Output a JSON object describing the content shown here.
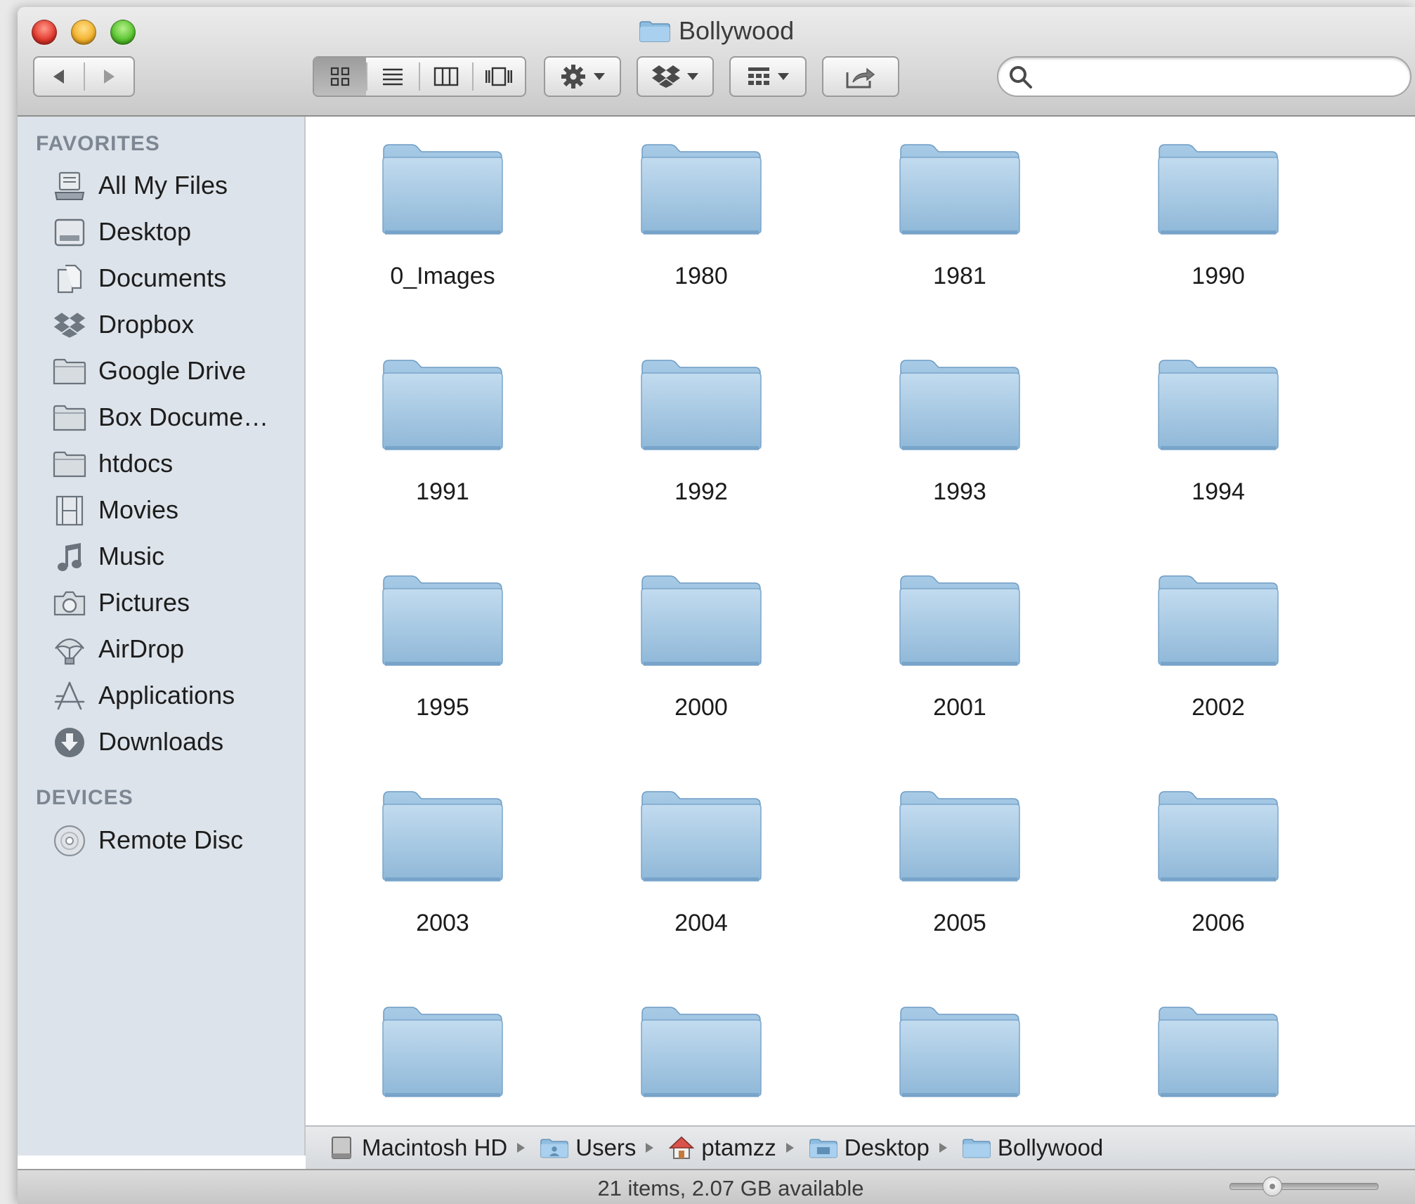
{
  "window": {
    "title": "Bollywood"
  },
  "toolbar": {
    "back_icon": "back-arrow-icon",
    "forward_icon": "forward-arrow-icon",
    "views": [
      "icon-view",
      "list-view",
      "column-view",
      "cover-flow-view"
    ],
    "active_view": "icon-view",
    "search": {
      "value": "",
      "placeholder": ""
    }
  },
  "sidebar": {
    "favorites_header": "FAVORITES",
    "favorites": [
      {
        "label": "All My Files",
        "icon": "all-files-icon"
      },
      {
        "label": "Desktop",
        "icon": "desktop-icon"
      },
      {
        "label": "Documents",
        "icon": "documents-icon"
      },
      {
        "label": "Dropbox",
        "icon": "dropbox-icon"
      },
      {
        "label": "Google Drive",
        "icon": "folder-icon"
      },
      {
        "label": "Box Docume…",
        "icon": "folder-icon"
      },
      {
        "label": "htdocs",
        "icon": "folder-icon"
      },
      {
        "label": "Movies",
        "icon": "movies-icon"
      },
      {
        "label": "Music",
        "icon": "music-icon"
      },
      {
        "label": "Pictures",
        "icon": "camera-icon"
      },
      {
        "label": "AirDrop",
        "icon": "airdrop-icon"
      },
      {
        "label": "Applications",
        "icon": "applications-icon"
      },
      {
        "label": "Downloads",
        "icon": "downloads-icon"
      }
    ],
    "devices_header": "DEVICES",
    "devices": [
      {
        "label": "Remote Disc",
        "icon": "disc-icon"
      }
    ]
  },
  "content": {
    "items": [
      "0_Images",
      "1980",
      "1981",
      "1990",
      "1991",
      "1992",
      "1993",
      "1994",
      "1995",
      "2000",
      "2001",
      "2002",
      "2003",
      "2004",
      "2005",
      "2006",
      "",
      "",
      "",
      ""
    ]
  },
  "pathbar": {
    "crumbs": [
      {
        "label": "Macintosh HD",
        "icon": "hard-drive-icon"
      },
      {
        "label": "Users",
        "icon": "users-folder-icon"
      },
      {
        "label": "ptamzz",
        "icon": "home-icon"
      },
      {
        "label": "Desktop",
        "icon": "desktop-folder-icon"
      },
      {
        "label": "Bollywood",
        "icon": "folder-icon"
      }
    ]
  },
  "statusbar": {
    "text": "21 items, 2.07 GB available",
    "icon_size_level": 0.25
  },
  "colors": {
    "sidebar_bg": "#dde3ea",
    "folder_blue": "#8fb8d8",
    "section_header": "#7d8793"
  }
}
